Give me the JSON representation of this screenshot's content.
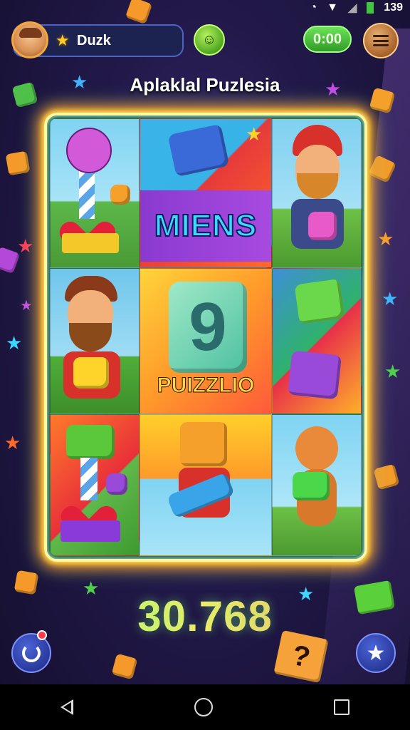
{
  "status": {
    "battery": "139"
  },
  "player": {
    "name": "Duzk"
  },
  "hud": {
    "timer": "0:00",
    "hint_symbol": "☺"
  },
  "level": {
    "title": "Aplaklal Puzlesia"
  },
  "board": {
    "banner_text": "MIENS",
    "center_number": "9",
    "center_text": "PUIZZLIO"
  },
  "score": {
    "value": "30.768"
  },
  "colors": {
    "accent_green": "#6ee35a",
    "frame_glow": "#ffe040",
    "background": "#22194a"
  },
  "icons": {
    "undo": "undo-icon",
    "star": "star-icon",
    "menu": "menu-icon",
    "hint": "hint-icon",
    "nav_back": "back-icon",
    "nav_home": "home-icon",
    "nav_recent": "recent-apps-icon"
  }
}
